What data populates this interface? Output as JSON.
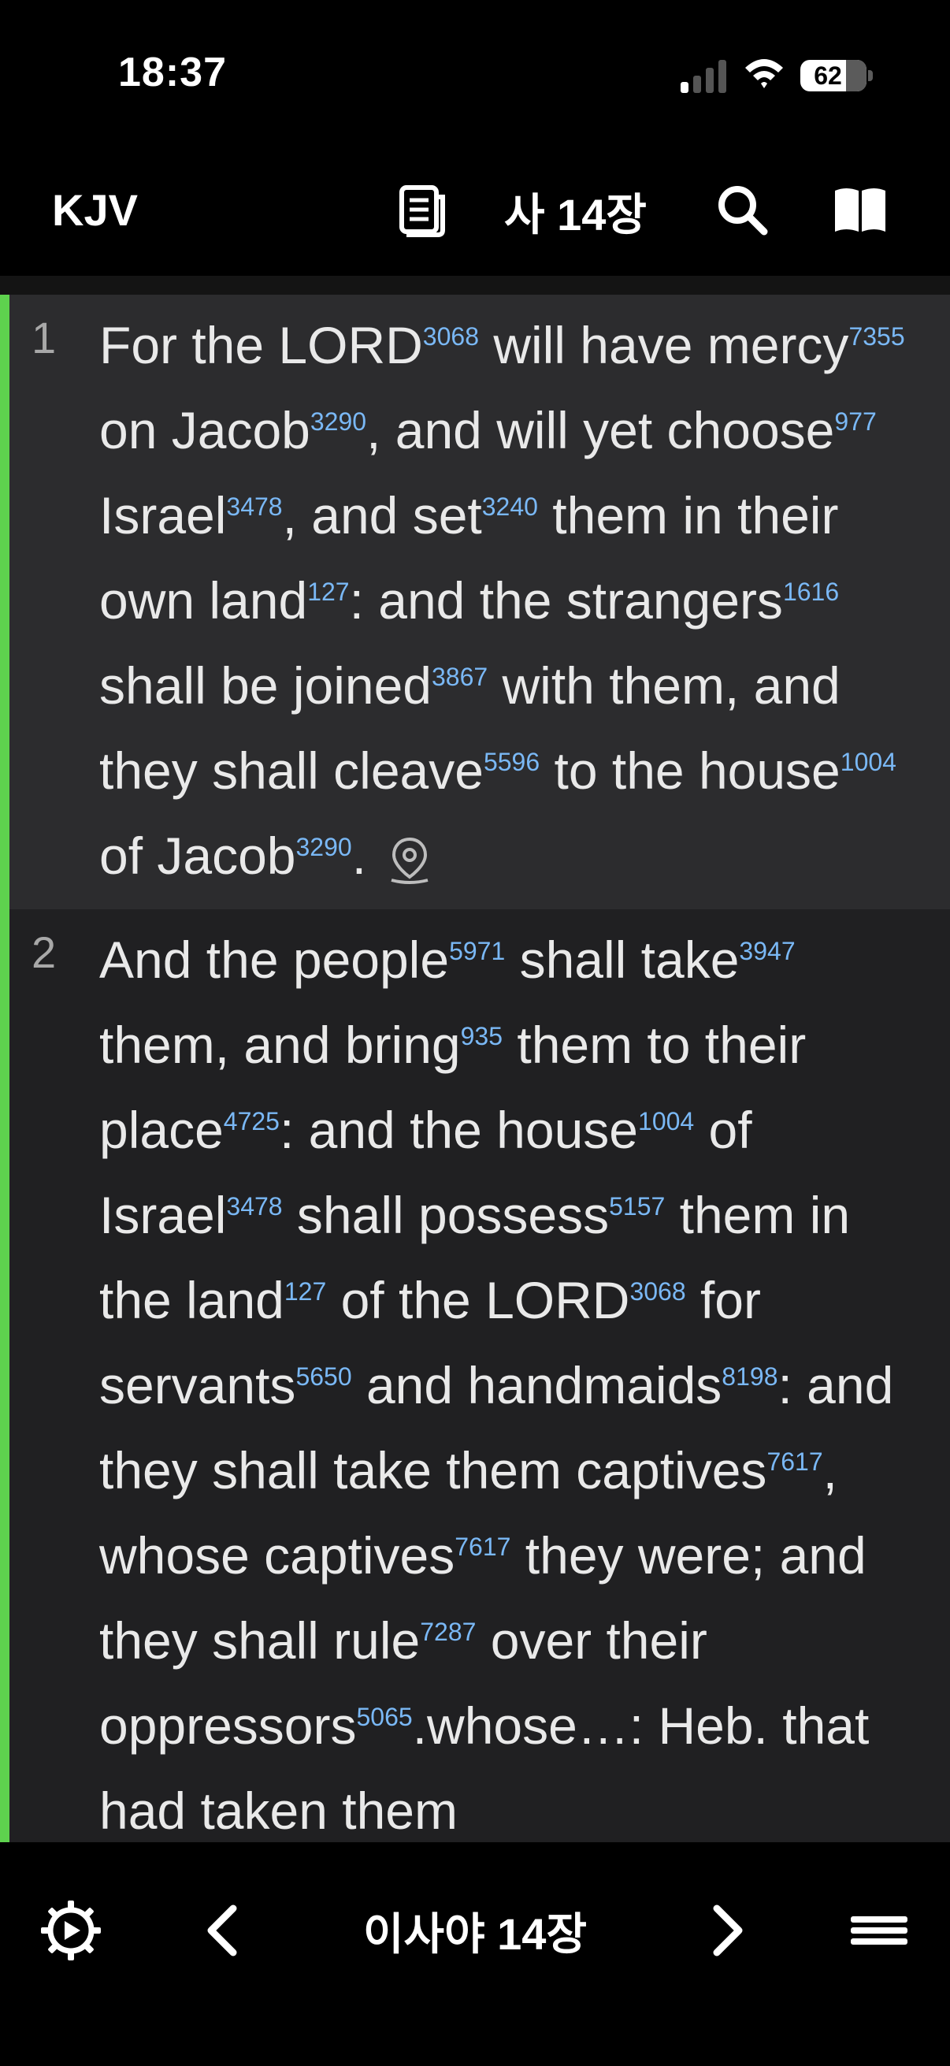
{
  "status_bar": {
    "time": "18:37",
    "battery": "62"
  },
  "header": {
    "translation": "KJV",
    "chapter": "사 14장"
  },
  "verses": [
    {
      "number": "1"
    },
    {
      "number": "2"
    }
  ],
  "bottom_bar": {
    "book_chapter": "이사야 14장"
  },
  "colors": {
    "accent": "#5ed24e",
    "strong_number": "#7ab8f5"
  }
}
